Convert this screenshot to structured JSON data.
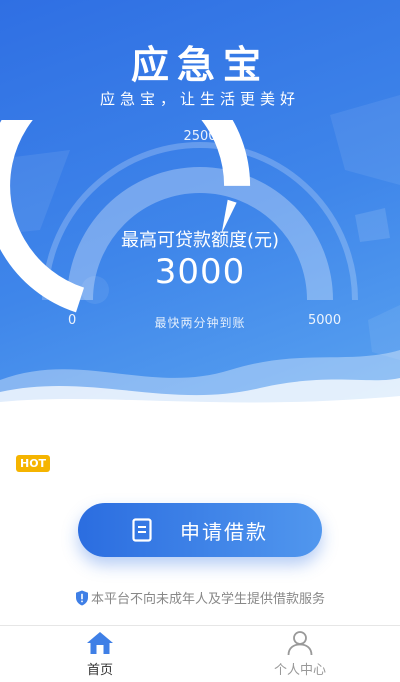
{
  "app": {
    "title": "应急宝",
    "slogan": "应急宝，让生活更美好"
  },
  "gauge": {
    "min_label": "0",
    "mid_label": "2500",
    "max_label": "5000",
    "limit_label": "最高可贷款额度(元)",
    "limit_value": "3000",
    "note": "最快两分钟到账",
    "fill_fraction": 0.6
  },
  "badge": {
    "hot": "HOT"
  },
  "apply_button": {
    "label": "申请借款",
    "icon": "document-icon"
  },
  "notice": {
    "text": "本平台不向未成年人及学生提供借款服务",
    "icon": "shield-icon"
  },
  "tabbar": {
    "items": [
      {
        "label": "首页",
        "icon": "home-icon",
        "active": true
      },
      {
        "label": "个人中心",
        "icon": "user-icon",
        "active": false
      }
    ]
  },
  "colors": {
    "primary": "#2f6fe3",
    "accent_light": "#5aa3f0",
    "hot_badge": "#f5b400"
  }
}
